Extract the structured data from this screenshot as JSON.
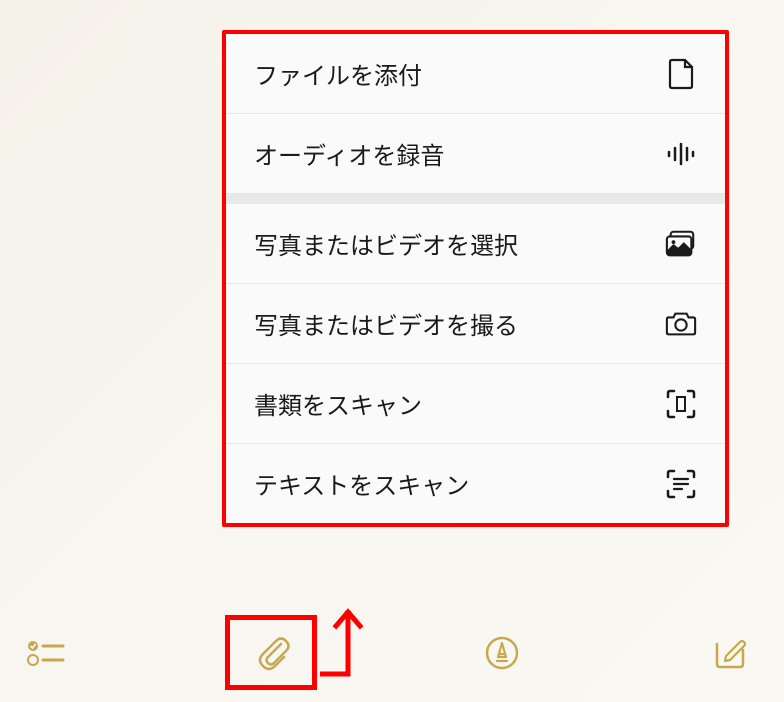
{
  "menu": {
    "groups": [
      {
        "items": [
          {
            "label": "ファイルを添付",
            "icon": "file-icon"
          },
          {
            "label": "オーディオを録音",
            "icon": "audio-icon"
          }
        ]
      },
      {
        "items": [
          {
            "label": "写真またはビデオを選択",
            "icon": "photo-library-icon"
          },
          {
            "label": "写真またはビデオを撮る",
            "icon": "camera-icon"
          },
          {
            "label": "書類をスキャン",
            "icon": "doc-scan-icon"
          },
          {
            "label": "テキストをスキャン",
            "icon": "text-scan-icon"
          }
        ]
      }
    ]
  },
  "toolbar": {
    "items": [
      "checklist",
      "attachment",
      "markup",
      "compose"
    ]
  },
  "colors": {
    "accent": "#c9a84d",
    "highlight": "#ff0000"
  }
}
